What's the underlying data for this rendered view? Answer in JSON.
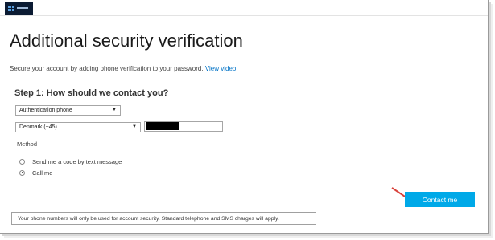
{
  "header": {
    "logo": "microsoft-logo"
  },
  "main": {
    "title": "Additional security verification",
    "subtitle": "Secure your account by adding phone verification to your password.",
    "video_link": "View video",
    "step1": {
      "title": "Step 1: How should we contact you?",
      "contact_method": "Authentication phone",
      "country": "Denmark (+45)",
      "phone_value": "",
      "method_label": "Method",
      "options": [
        {
          "label": "Send me a code by text message",
          "checked": false
        },
        {
          "label": "Call me",
          "checked": true
        }
      ]
    },
    "contact_button": "Contact me",
    "notice": "Your phone numbers will only be used for account security. Standard telephone and SMS charges will apply."
  },
  "colors": {
    "accent": "#00a9e8",
    "link": "#0072c6",
    "arrow": "#d9413a"
  }
}
